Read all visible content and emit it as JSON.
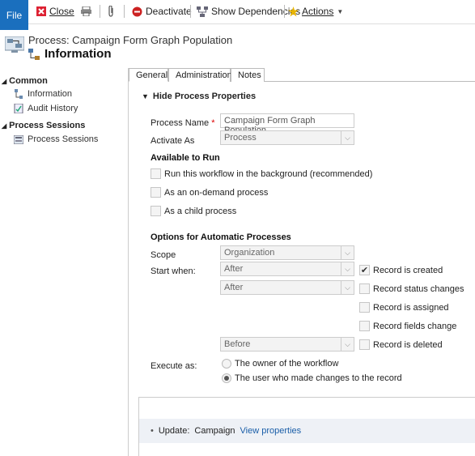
{
  "toolbar": {
    "file": "File",
    "close": "Close",
    "deactivate": "Deactivate",
    "show_dependencies": "Show Dependencies",
    "actions": "Actions"
  },
  "header": {
    "process_label": "Process: Campaign Form Graph Population",
    "title": "Information"
  },
  "nav": {
    "common": "Common",
    "information": "Information",
    "audit_history": "Audit History",
    "process_sessions_group": "Process Sessions",
    "process_sessions": "Process Sessions"
  },
  "tabs": [
    "General",
    "Administration",
    "Notes"
  ],
  "form": {
    "section_title": "Hide Process Properties",
    "process_name_label": "Process Name",
    "required_mark": "*",
    "process_name_value": "Campaign Form Graph Population",
    "activate_as_label": "Activate As",
    "activate_as_value": "Process",
    "available_to_run": "Available to Run",
    "run_background": "Run this workflow in the background (recommended)",
    "on_demand": "As an on-demand process",
    "child_process": "As a child process",
    "options_auto": "Options for Automatic Processes",
    "scope_label": "Scope",
    "scope_value": "Organization",
    "start_when_label": "Start when:",
    "start_when_1": "After",
    "start_when_2": "After",
    "start_when_3": "Before",
    "record_created": "Record is created",
    "record_status": "Record status changes",
    "record_assigned": "Record is assigned",
    "record_fields": "Record fields change",
    "record_deleted": "Record is deleted",
    "execute_as_label": "Execute as:",
    "exec_owner": "The owner of the workflow",
    "exec_user": "The user who made changes to the record"
  },
  "steps": {
    "bullet": "•",
    "update_label": "Update:",
    "entity": "Campaign",
    "view_properties": "View properties"
  },
  "state": {
    "record_created_checked": true,
    "exec_user_selected": true
  }
}
